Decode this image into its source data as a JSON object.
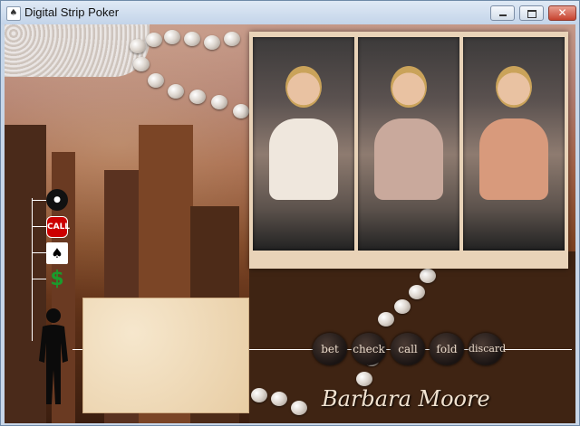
{
  "window": {
    "title": "Digital Strip Poker",
    "close_glyph": "✕"
  },
  "actions": {
    "pot_icon": "pot-icon",
    "call_badge": "CALL",
    "cards_glyph": "♠",
    "money_glyph": "$"
  },
  "buttons": {
    "bet": "bet",
    "check": "check",
    "call": "call",
    "fold": "fold",
    "discard": "discard"
  },
  "player": {
    "name": "Barbara Moore"
  }
}
